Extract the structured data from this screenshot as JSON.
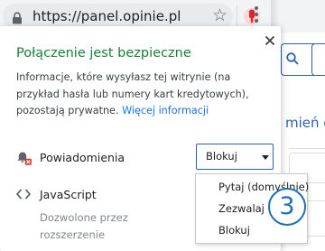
{
  "browser": {
    "url": "https://panel.opinie.pl",
    "icons": {
      "lock": "lock-icon",
      "bookmark": "star-icon",
      "extension": "extension-icon",
      "menu": "kebab-menu-icon"
    }
  },
  "background_page": {
    "link_fragment": "mień c"
  },
  "popup": {
    "title": "Połączenie jest bezpieczne",
    "description": "Informacje, które wysyłasz tej witrynie (na przykład hasła lub numery kart kredytowych), pozostają prywatne.",
    "more_info_link": "Więcej informacji",
    "permissions": [
      {
        "label": "Powiadomienia",
        "icon": "notifications-blocked-icon",
        "select_value": "Blokuj"
      },
      {
        "label": "JavaScript",
        "icon": "code-icon",
        "sublabel": "Dozwolone przez rozszerzenie"
      }
    ]
  },
  "dropdown": {
    "options": [
      "Pytaj (domyślnie)",
      "Zezwalaj",
      "Blokuj"
    ]
  },
  "callout": {
    "number": "3"
  },
  "colors": {
    "secure_green": "#188038",
    "link_blue": "#1a73e8",
    "select_border": "#2b5fb3",
    "callout_blue": "#1f6fb8"
  }
}
